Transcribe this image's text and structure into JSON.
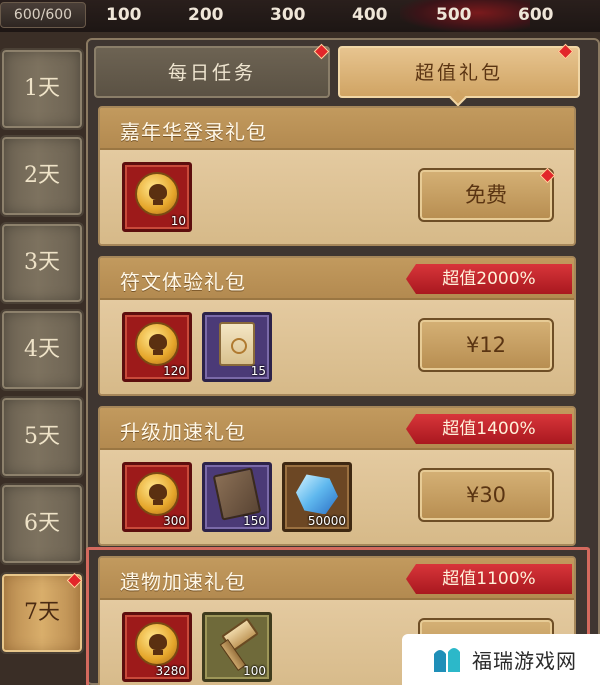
{
  "topbar": {
    "progress": "600/600",
    "milestones": [
      "100",
      "200",
      "300",
      "400",
      "500",
      "600"
    ]
  },
  "days": [
    "1天",
    "2天",
    "3天",
    "4天",
    "5天",
    "6天",
    "7天"
  ],
  "active_day_index": 6,
  "tabs": {
    "daily": "每日任务",
    "value": "超值礼包"
  },
  "packs": [
    {
      "title": "嘉年华登录礼包",
      "badge": "",
      "price": "免费",
      "items": [
        {
          "icon": "skull-coin-icon",
          "qty": "10"
        }
      ]
    },
    {
      "title": "符文体验礼包",
      "badge": "超值2000%",
      "price": "¥12",
      "items": [
        {
          "icon": "skull-coin-icon",
          "qty": "120"
        },
        {
          "icon": "rune-scroll-icon",
          "qty": "15"
        }
      ]
    },
    {
      "title": "升级加速礼包",
      "badge": "超值1400%",
      "price": "¥30",
      "items": [
        {
          "icon": "skull-coin-icon",
          "qty": "300"
        },
        {
          "icon": "map-scroll-icon",
          "qty": "150"
        },
        {
          "icon": "blue-crystal-icon",
          "qty": "50000"
        }
      ]
    },
    {
      "title": "遗物加速礼包",
      "badge": "超值1100%",
      "price": "",
      "items": [
        {
          "icon": "skull-coin-icon",
          "qty": "3280"
        },
        {
          "icon": "hammer-icon",
          "qty": "100"
        }
      ]
    }
  ],
  "watermark": {
    "text": "福瑞游戏网"
  },
  "colors": {
    "ribbon": "#c8262c",
    "notify_dot": "#e2262a",
    "highlight_border": "#d46a5e",
    "gold_tab": "#d9ae6b"
  }
}
